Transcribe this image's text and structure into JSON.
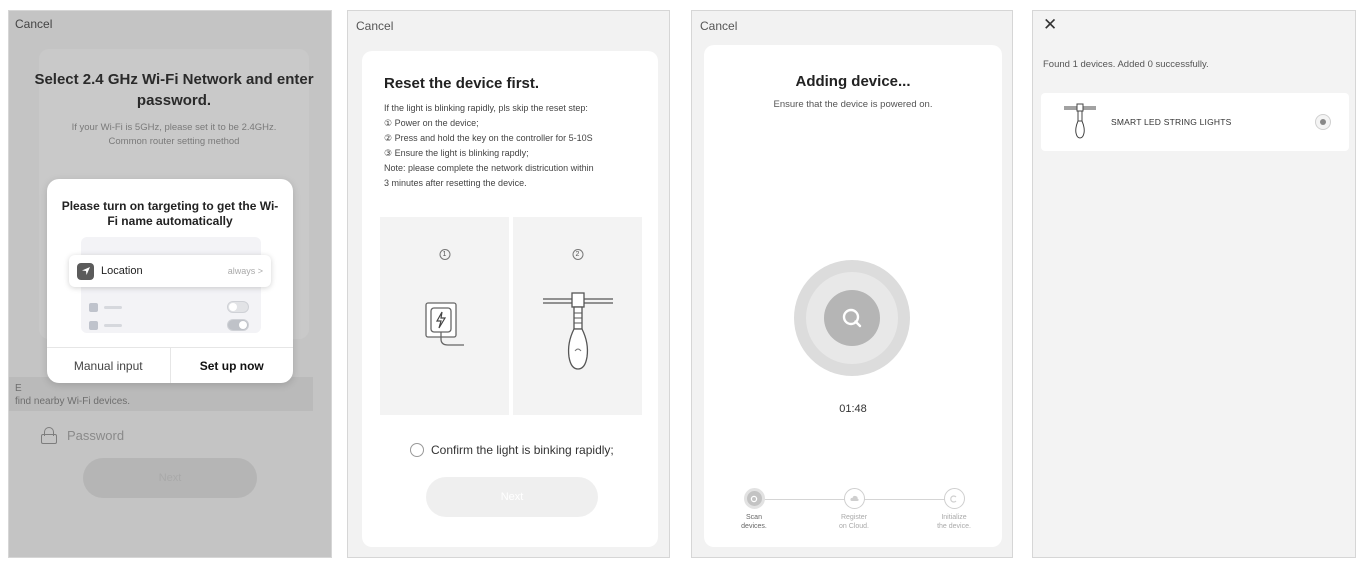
{
  "panel1": {
    "cancel": "Cancel",
    "title": "Select 2.4 GHz Wi-Fi Network and enter password.",
    "subtitle_line1": "If your Wi-Fi is 5GHz, please set it to be 2.4GHz.",
    "subtitle_line2": "Common router setting method",
    "hint_line1": "E",
    "hint_line2": "find nearby Wi-Fi devices.",
    "password_placeholder": "Password",
    "next_label": "Next",
    "dialog": {
      "title": "Please turn on targeting to get the Wi-Fi name automatically",
      "location_label": "Location",
      "location_value": "always",
      "manual_button": "Manual input",
      "setup_button": "Set up now"
    }
  },
  "panel2": {
    "cancel": "Cancel",
    "title": "Reset the device first.",
    "steps": [
      "If the light is blinking rapidly, pls skip the reset step:",
      "① Power on the device;",
      "② Press and hold the key on the controller for 5-10S",
      "③ Ensure the light is blinking rapdly;",
      "Note: please complete the network districution within",
      "3 minutes after resetting the device."
    ],
    "illus_step1": "1",
    "illus_step2": "2",
    "confirm_label": "Confirm the light is binking rapidly;",
    "next_label": "Next"
  },
  "panel3": {
    "cancel": "Cancel",
    "title": "Adding device...",
    "subtitle": "Ensure that the device is powered on.",
    "timer": "01:48",
    "steps": [
      {
        "line1": "Scan",
        "line2": "devices."
      },
      {
        "line1": "Register",
        "line2": "on Cloud."
      },
      {
        "line1": "Initialize",
        "line2": "the device."
      }
    ]
  },
  "panel4": {
    "found_text": "Found 1 devices. Added 0 successfully.",
    "device_name": "SMART LED STRING LIGHTS"
  },
  "icons": {
    "close": "close-icon",
    "lock": "lock-icon",
    "location": "location-arrow-icon",
    "search": "search-icon",
    "plug": "plug-icon",
    "bulb": "string-light-icon"
  }
}
